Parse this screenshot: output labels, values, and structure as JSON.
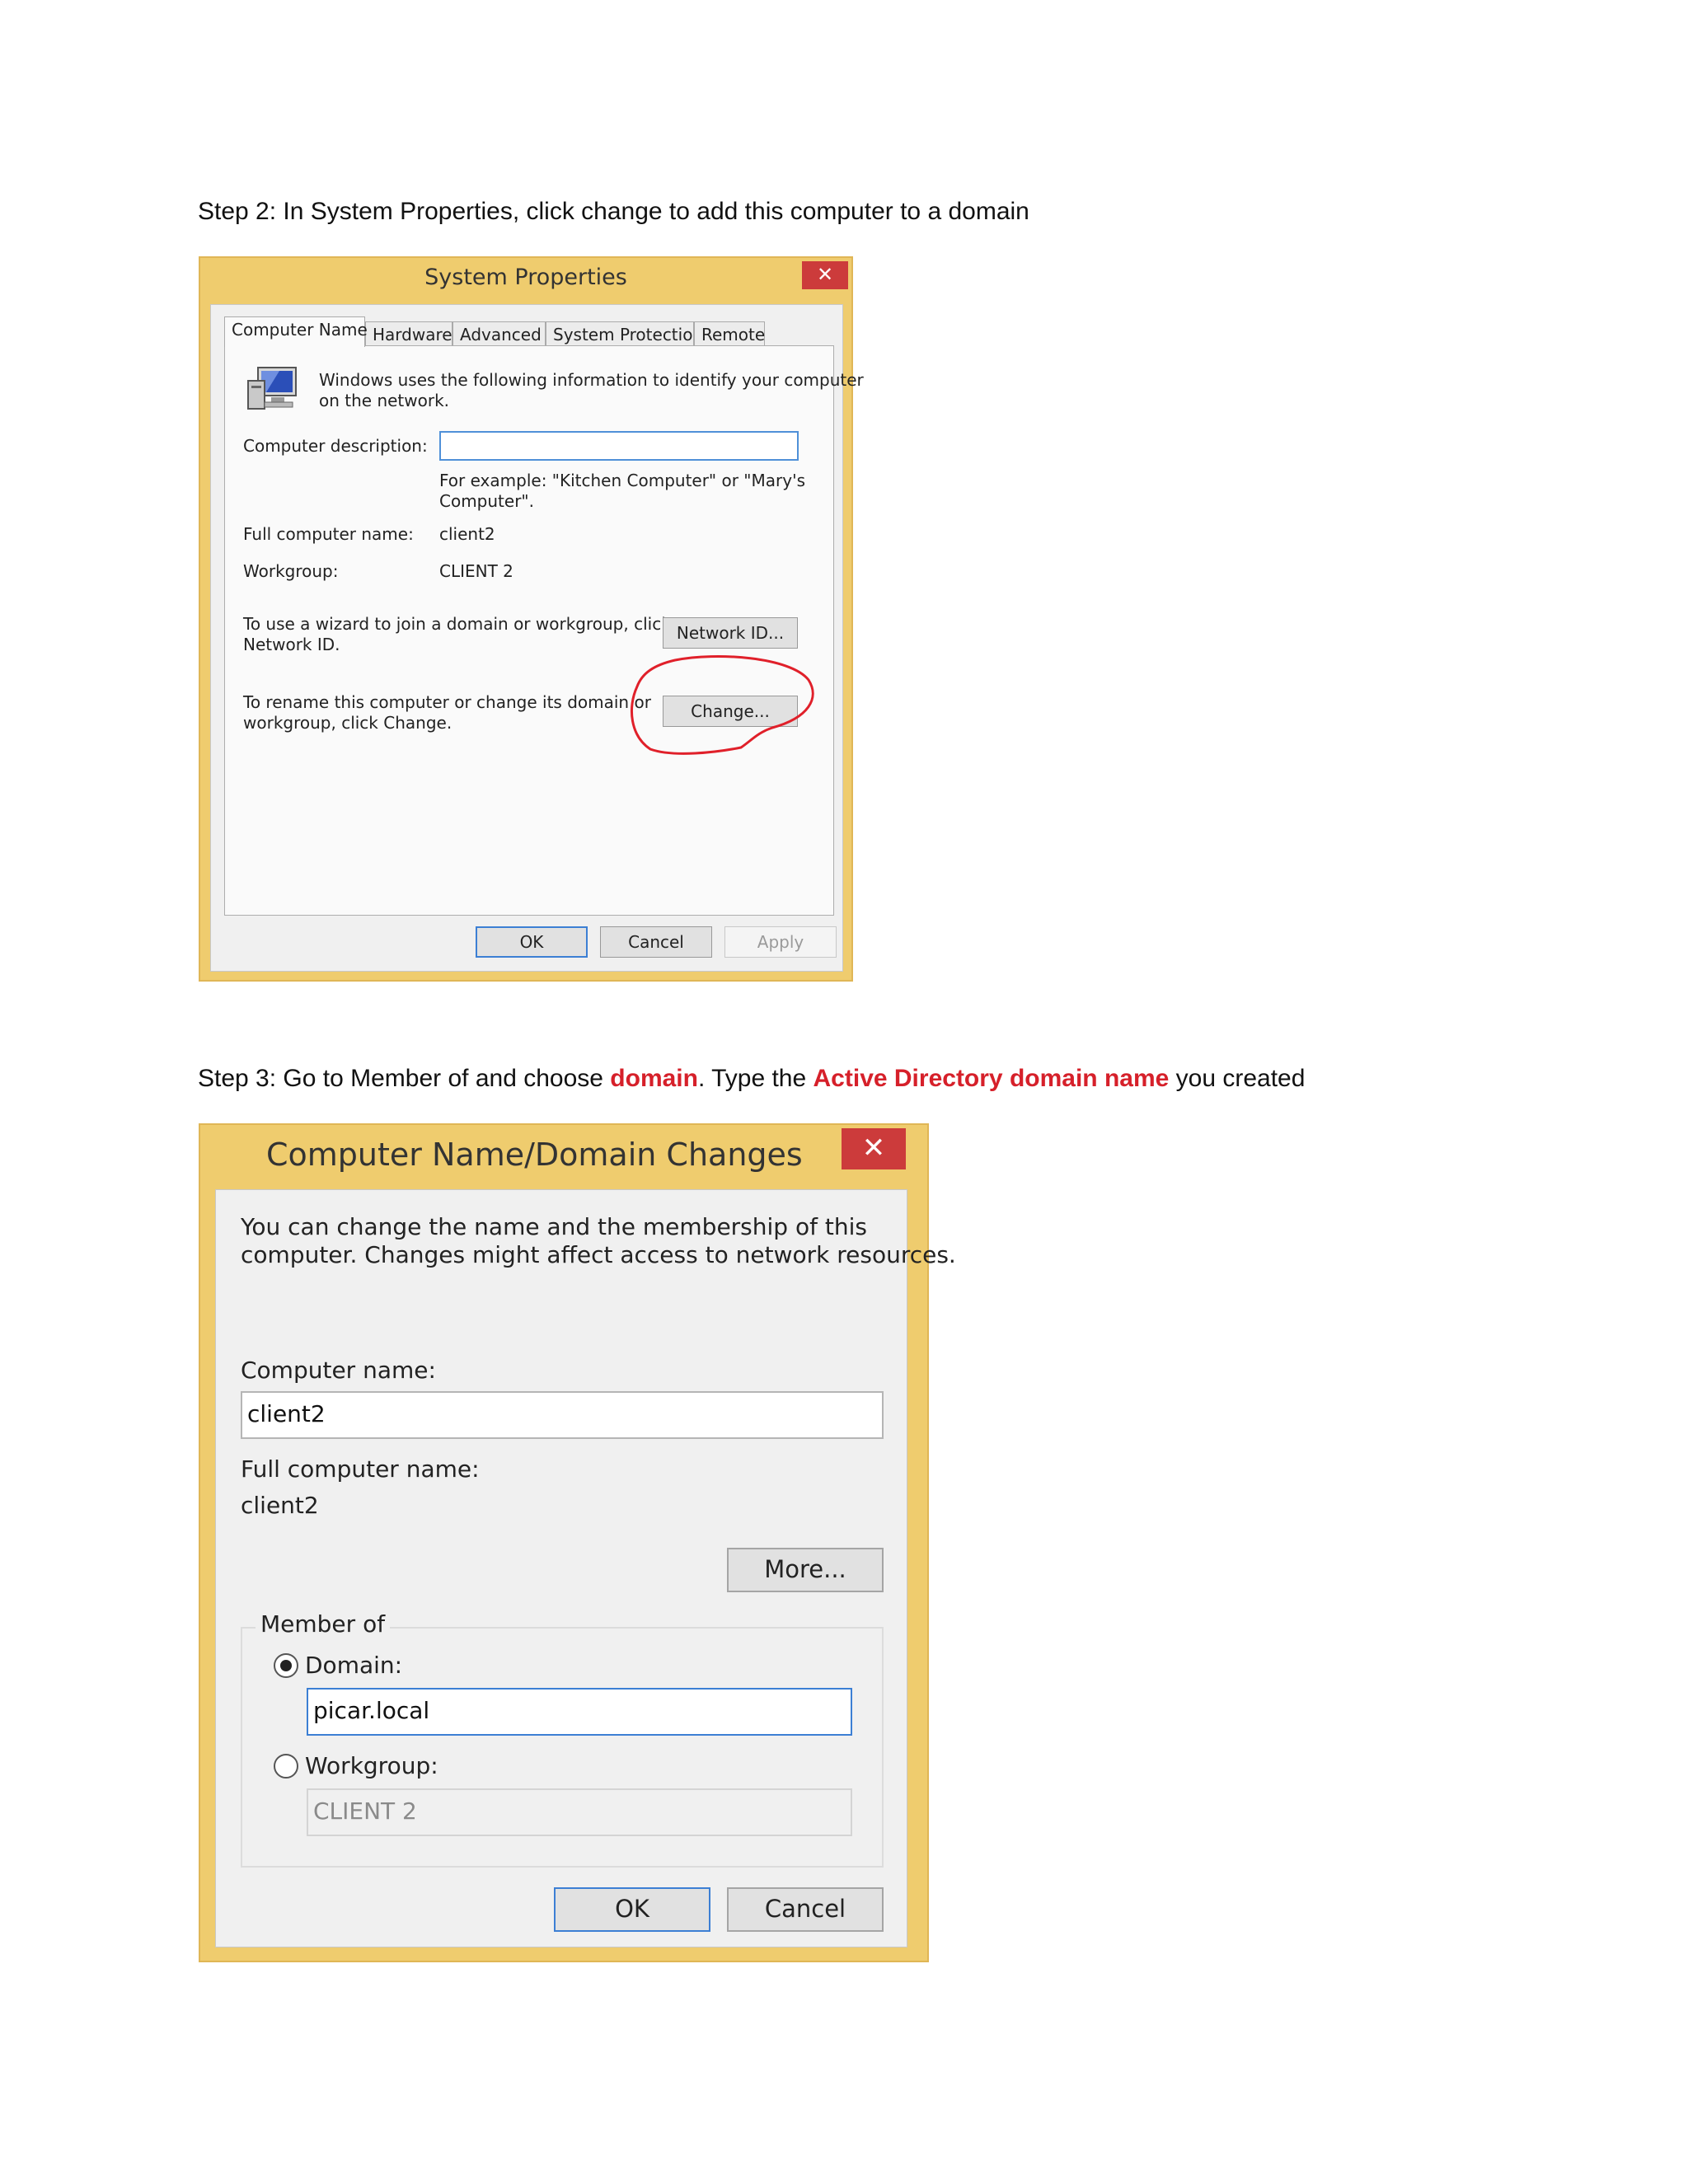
{
  "step2": {
    "caption": "Step 2: In System Properties, click change to add this computer to a domain",
    "window": {
      "title": "System Properties",
      "close_glyph": "✕",
      "tabs": [
        "Computer Name",
        "Hardware",
        "Advanced",
        "System Protection",
        "Remote"
      ],
      "intro_line1": "Windows uses the following information to identify your computer",
      "intro_line2": "on the network.",
      "description_label": "Computer description:",
      "description_value": "",
      "example_line1": "For example: \"Kitchen Computer\" or \"Mary's",
      "example_line2": "Computer\".",
      "full_name_label": "Full computer name:",
      "full_name_value": "client2",
      "workgroup_label": "Workgroup:",
      "workgroup_value": "CLIENT 2",
      "wizard_line1": "To use a wizard to join a domain or workgroup, click",
      "wizard_line2": "Network ID.",
      "network_id_button": "Network ID...",
      "rename_line1": "To rename this computer or change its domain or",
      "rename_line2": "workgroup, click Change.",
      "change_button": "Change...",
      "ok_button": "OK",
      "cancel_button": "Cancel",
      "apply_button": "Apply",
      "annotation_color": "#e0202a"
    }
  },
  "step3": {
    "caption_pre": "Step 3: Go to Member of and choose ",
    "caption_hl1": "domain",
    "caption_mid": ". Type the ",
    "caption_hl2": "Active Directory domain name",
    "caption_post": " you created",
    "highlight_color": "#d6202a",
    "window": {
      "title": "Computer Name/Domain Changes",
      "close_glyph": "✕",
      "intro_line1": "You can change the name and the membership of this",
      "intro_line2": "computer. Changes might affect access to network resources.",
      "computer_name_label": "Computer name:",
      "computer_name_value": "client2",
      "full_name_label": "Full computer name:",
      "full_name_value": "client2",
      "more_button": "More...",
      "member_of_label": "Member of",
      "domain_label": "Domain:",
      "domain_value": "picar.local",
      "domain_selected": true,
      "workgroup_label": "Workgroup:",
      "workgroup_value": "CLIENT 2",
      "ok_button": "OK",
      "cancel_button": "Cancel"
    }
  },
  "colors": {
    "window_frame": "#efcc6e",
    "close_button": "#cc3b3b",
    "focus_border": "#3c7fd4"
  }
}
